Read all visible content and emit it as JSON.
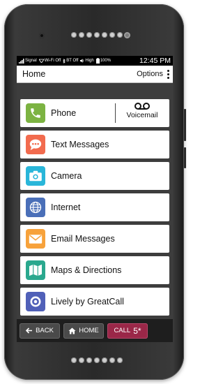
{
  "status_bar": {
    "signal": "Signal",
    "wifi": "Wi-Fi Off",
    "bluetooth": "BT Off",
    "volume": "High",
    "battery": "100%",
    "time": "12:45 PM"
  },
  "header": {
    "title": "Home",
    "options_label": "Options"
  },
  "menu": {
    "items": [
      {
        "label": "Phone",
        "icon": "phone-icon",
        "color": "#7cb342"
      },
      {
        "label": "Text Messages",
        "icon": "speech-bubble-icon",
        "color": "#f26b4e"
      },
      {
        "label": "Camera",
        "icon": "camera-icon",
        "color": "#29b6d9"
      },
      {
        "label": "Internet",
        "icon": "globe-icon",
        "color": "#4a6fb8"
      },
      {
        "label": "Email Messages",
        "icon": "envelope-icon",
        "color": "#f7a23b"
      },
      {
        "label": "Maps & Directions",
        "icon": "map-icon",
        "color": "#2aa88e"
      },
      {
        "label": "Lively by GreatCall",
        "icon": "lively-icon",
        "color": "#5060b8"
      }
    ],
    "voicemail_label": "Voicemail"
  },
  "nav": {
    "back_label": "BACK",
    "home_label": "HOME",
    "call_label": "CALL",
    "call_number": "5*"
  },
  "colors": {
    "call_button": "#9a2748",
    "screen_background": "#3d3d3d"
  }
}
